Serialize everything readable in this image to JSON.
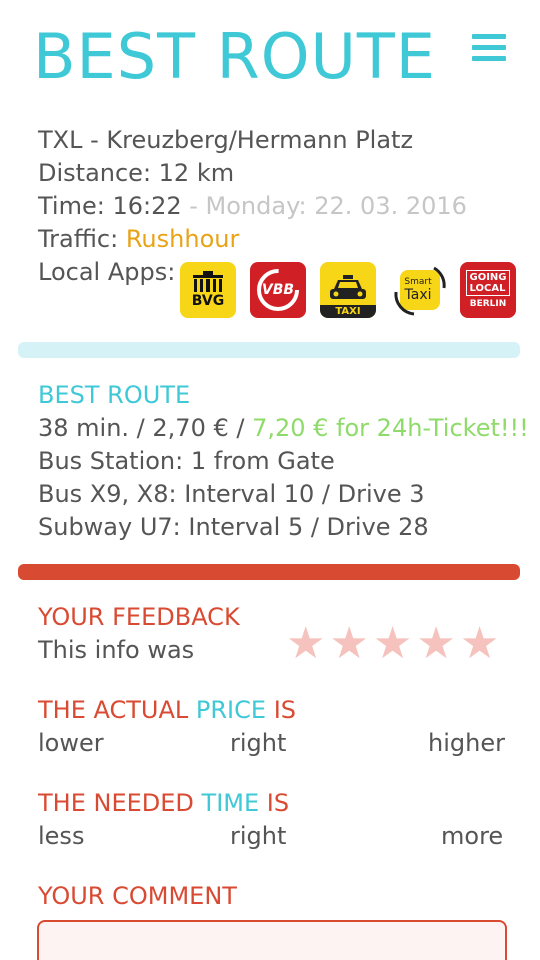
{
  "header": {
    "title": "BEST ROUTE",
    "menu_icon": "hamburger-menu-icon"
  },
  "trip": {
    "route": "TXL - Kreuzberg/Hermann Platz",
    "distance": "Distance: 12 km",
    "time_label": "Time: 16:22",
    "date": " - Monday: 22. 03. 2016",
    "traffic_label": "Traffic: ",
    "traffic_value": "Rushhour",
    "local_apps_label": "Local Apps:"
  },
  "apps": [
    {
      "name": "BVG",
      "icon": "bvg-app-icon"
    },
    {
      "name": "VBB",
      "icon": "vbb-app-icon"
    },
    {
      "name": "TAXI",
      "icon": "taxi-app-icon"
    },
    {
      "name": "Smart Taxi",
      "small": "Smart",
      "big": "Taxi",
      "icon": "smart-taxi-app-icon"
    },
    {
      "name": "Going Local Berlin",
      "l1": "GOING",
      "l2": "LOCAL",
      "l3": "BERLIN",
      "icon": "going-local-berlin-app-icon"
    }
  ],
  "best_route": {
    "heading": "BEST ROUTE",
    "price_line": "38 min. / 2,70 € / ",
    "ticket": "7,20 € for 24h-Ticket!!!",
    "bus_station": "Bus Station: 1 from Gate",
    "bus": "Bus X9, X8: Interval 10 /  Drive 3",
    "subway": "Subway U7: Interval 5 / Drive 28"
  },
  "feedback": {
    "heading": "YOUR FEEDBACK",
    "info_label": "This info was",
    "star_count": 5,
    "star_glyph": "★",
    "price_heading_1": "THE ACTUAL ",
    "price_heading_2": "PRICE",
    "price_heading_3": " IS",
    "price_options": [
      "lower",
      "right",
      "higher"
    ],
    "time_heading_1": "THE NEEDED ",
    "time_heading_2": "TIME",
    "time_heading_3": " IS",
    "time_options": [
      "less",
      "right",
      "more"
    ],
    "comment_heading": "YOUR COMMENT"
  },
  "colors": {
    "accent": "#3fc8d6",
    "feedback_red": "#d94a32",
    "traffic_orange": "#e8a317",
    "ticket_green": "#8edb6a"
  }
}
